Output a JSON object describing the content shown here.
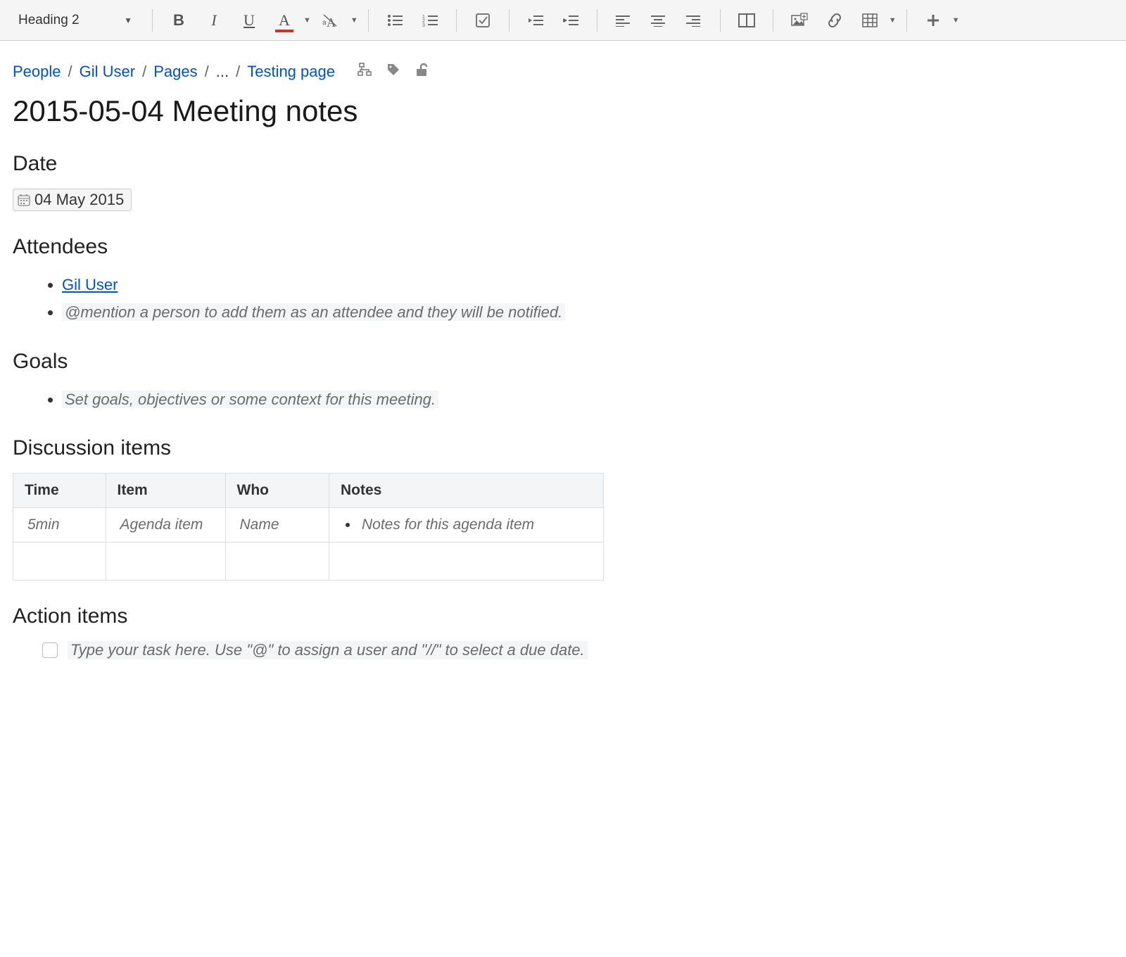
{
  "toolbar": {
    "style_select": "Heading 2"
  },
  "breadcrumb": {
    "items": [
      "People",
      "Gil User",
      "Pages",
      "...",
      "Testing page"
    ]
  },
  "page": {
    "title": "2015-05-04 Meeting notes"
  },
  "sections": {
    "date_heading": "Date",
    "date_value": "04 May 2015",
    "attendees_heading": "Attendees",
    "attendees_link": "Gil User",
    "attendees_placeholder": "@mention a person to add them as an attendee and they will be notified.",
    "goals_heading": "Goals",
    "goals_placeholder": "Set goals, objectives or some context for this meeting.",
    "discussion_heading": "Discussion items",
    "action_heading": "Action items",
    "action_placeholder": "Type your task here. Use \"@\" to assign a user and \"//\" to select a due date."
  },
  "table": {
    "headers": {
      "time": "Time",
      "item": "Item",
      "who": "Who",
      "notes": "Notes"
    },
    "row1": {
      "time": "5min",
      "item": "Agenda item",
      "who": "Name",
      "notes": "Notes for this agenda item"
    }
  }
}
